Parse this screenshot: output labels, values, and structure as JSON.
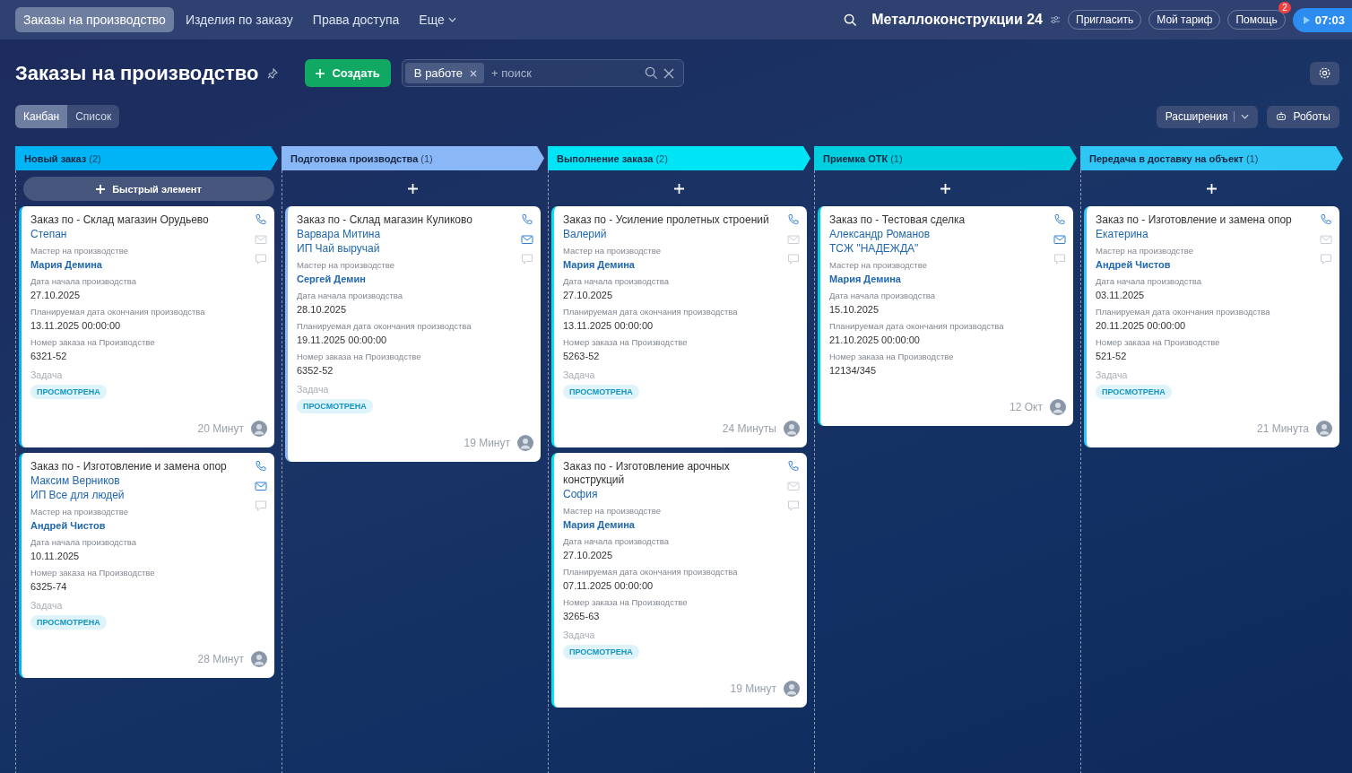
{
  "top_nav": {
    "tabs": [
      {
        "label": "Заказы на производство",
        "selected": true
      },
      {
        "label": "Изделия по заказу",
        "selected": false
      },
      {
        "label": "Права доступа",
        "selected": false
      }
    ],
    "more": "Еще",
    "brand": "Металлоконструкции",
    "brand_num": "24",
    "buttons": [
      "Пригласить",
      "Мой тариф",
      "Помощь"
    ],
    "help_badge": "2",
    "timer": "07:03"
  },
  "header": {
    "title": "Заказы на производство",
    "create": "Создать",
    "filter_tag": "В работе",
    "search_placeholder": "+ поиск"
  },
  "views": [
    {
      "label": "Канбан",
      "selected": true
    },
    {
      "label": "Список",
      "selected": false
    }
  ],
  "extensions": "Расширения",
  "robots": "Роботы",
  "columns": [
    {
      "title": "Новый заказ",
      "count": "(2)",
      "color": "#00b4f5",
      "quick_add": "Быстрый элемент",
      "cards": [
        {
          "title": "Заказ по - Склад магазин Орудьево",
          "contacts": [
            "Степан"
          ],
          "email_active": false,
          "fields": [
            {
              "label": "Мастер на производстве",
              "value": "Мария Демина",
              "kind": "link"
            },
            {
              "label": "Дата начала производства",
              "value": "27.10.2025",
              "kind": "text"
            },
            {
              "label": "Планируемая дата окончания производства",
              "value": "13.11.2025 00:00:00",
              "kind": "text"
            },
            {
              "label": "Номер заказа на Производстве",
              "value": "6321-52",
              "kind": "text"
            }
          ],
          "task_label": "Задача",
          "task_status": "ПРОСМОТРЕНА",
          "time": "20 Минут"
        },
        {
          "title": "Заказ по - Изготовление и замена опор",
          "contacts": [
            "Максим Верников",
            "ИП Все для людей"
          ],
          "email_active": true,
          "fields": [
            {
              "label": "Мастер на производстве",
              "value": "Андрей Чистов",
              "kind": "link"
            },
            {
              "label": "Дата начала производства",
              "value": "10.11.2025",
              "kind": "text"
            },
            {
              "label": "Номер заказа на Производстве",
              "value": "6325-74",
              "kind": "text"
            }
          ],
          "task_label": "Задача",
          "task_status": "ПРОСМОТРЕНА",
          "time": "28 Минут"
        }
      ]
    },
    {
      "title": "Подготовка производства",
      "count": "(1)",
      "color": "#8ab8f7",
      "cards": [
        {
          "title": "Заказ по - Склад магазин Куликово",
          "contacts": [
            "Варвара Митина",
            "ИП Чай выручай"
          ],
          "email_active": true,
          "fields": [
            {
              "label": "Мастер на производстве",
              "value": "Сергей Демин",
              "kind": "link"
            },
            {
              "label": "Дата начала производства",
              "value": "28.10.2025",
              "kind": "text"
            },
            {
              "label": "Планируемая дата окончания производства",
              "value": "19.11.2025 00:00:00",
              "kind": "text"
            },
            {
              "label": "Номер заказа на Производстве",
              "value": "6352-52",
              "kind": "text"
            }
          ],
          "task_label": "Задача",
          "task_status": "ПРОСМОТРЕНА",
          "time": "19 Минут"
        }
      ]
    },
    {
      "title": "Выполнение заказа",
      "count": "(2)",
      "color": "#00e5f5",
      "cards": [
        {
          "title": "Заказ по - Усиление пролетных строений",
          "contacts": [
            "Валерий"
          ],
          "email_active": false,
          "fields": [
            {
              "label": "Мастер на производстве",
              "value": "Мария Демина",
              "kind": "link"
            },
            {
              "label": "Дата начала производства",
              "value": "27.10.2025",
              "kind": "text"
            },
            {
              "label": "Планируемая дата окончания производства",
              "value": "13.11.2025 00:00:00",
              "kind": "text"
            },
            {
              "label": "Номер заказа на Производстве",
              "value": "5263-52",
              "kind": "text"
            }
          ],
          "task_label": "Задача",
          "task_status": "ПРОСМОТРЕНА",
          "time": "24 Минуты"
        },
        {
          "title": "Заказ по - Изготовление арочных конструкций",
          "contacts": [
            "София"
          ],
          "email_active": false,
          "fields": [
            {
              "label": "Мастер на производстве",
              "value": "Мария Демина",
              "kind": "link"
            },
            {
              "label": "Дата начала производства",
              "value": "27.10.2025",
              "kind": "text"
            },
            {
              "label": "Планируемая дата окончания производства",
              "value": "07.11.2025 00:00:00",
              "kind": "text"
            },
            {
              "label": "Номер заказа на Производстве",
              "value": "3265-63",
              "kind": "text"
            }
          ],
          "task_label": "Задача",
          "task_status": "ПРОСМОТРЕНА",
          "time": "19 Минут"
        }
      ]
    },
    {
      "title": "Приемка ОТК",
      "count": "(1)",
      "color": "#00cfe0",
      "cards": [
        {
          "title": "Заказ по - Тестовая сделка",
          "contacts": [
            "Александр Романов",
            "ТСЖ \"НАДЕЖДА\""
          ],
          "email_active": true,
          "fields": [
            {
              "label": "Мастер на производстве",
              "value": "Мария Демина",
              "kind": "link"
            },
            {
              "label": "Дата начала производства",
              "value": "15.10.2025",
              "kind": "text"
            },
            {
              "label": "Планируемая дата окончания производства",
              "value": "21.10.2025 00:00:00",
              "kind": "text"
            },
            {
              "label": "Номер заказа на Производстве",
              "value": "12134/345",
              "kind": "text"
            }
          ],
          "time": "12 Окт"
        }
      ]
    },
    {
      "title": "Передача в доставку на объект",
      "count": "(1)",
      "color": "#2fc6f6",
      "cards": [
        {
          "title": "Заказ по - Изготовление и замена опор",
          "contacts": [
            "Екатерина"
          ],
          "email_active": false,
          "fields": [
            {
              "label": "Мастер на производстве",
              "value": "Андрей Чистов",
              "kind": "link"
            },
            {
              "label": "Дата начала производства",
              "value": "03.11.2025",
              "kind": "text"
            },
            {
              "label": "Планируемая дата окончания производства",
              "value": "20.11.2025 00:00:00",
              "kind": "text"
            },
            {
              "label": "Номер заказа на Производстве",
              "value": "521-52",
              "kind": "text"
            }
          ],
          "task_label": "Задача",
          "task_status": "ПРОСМОТРЕНА",
          "time": "21 Минута"
        }
      ]
    }
  ]
}
